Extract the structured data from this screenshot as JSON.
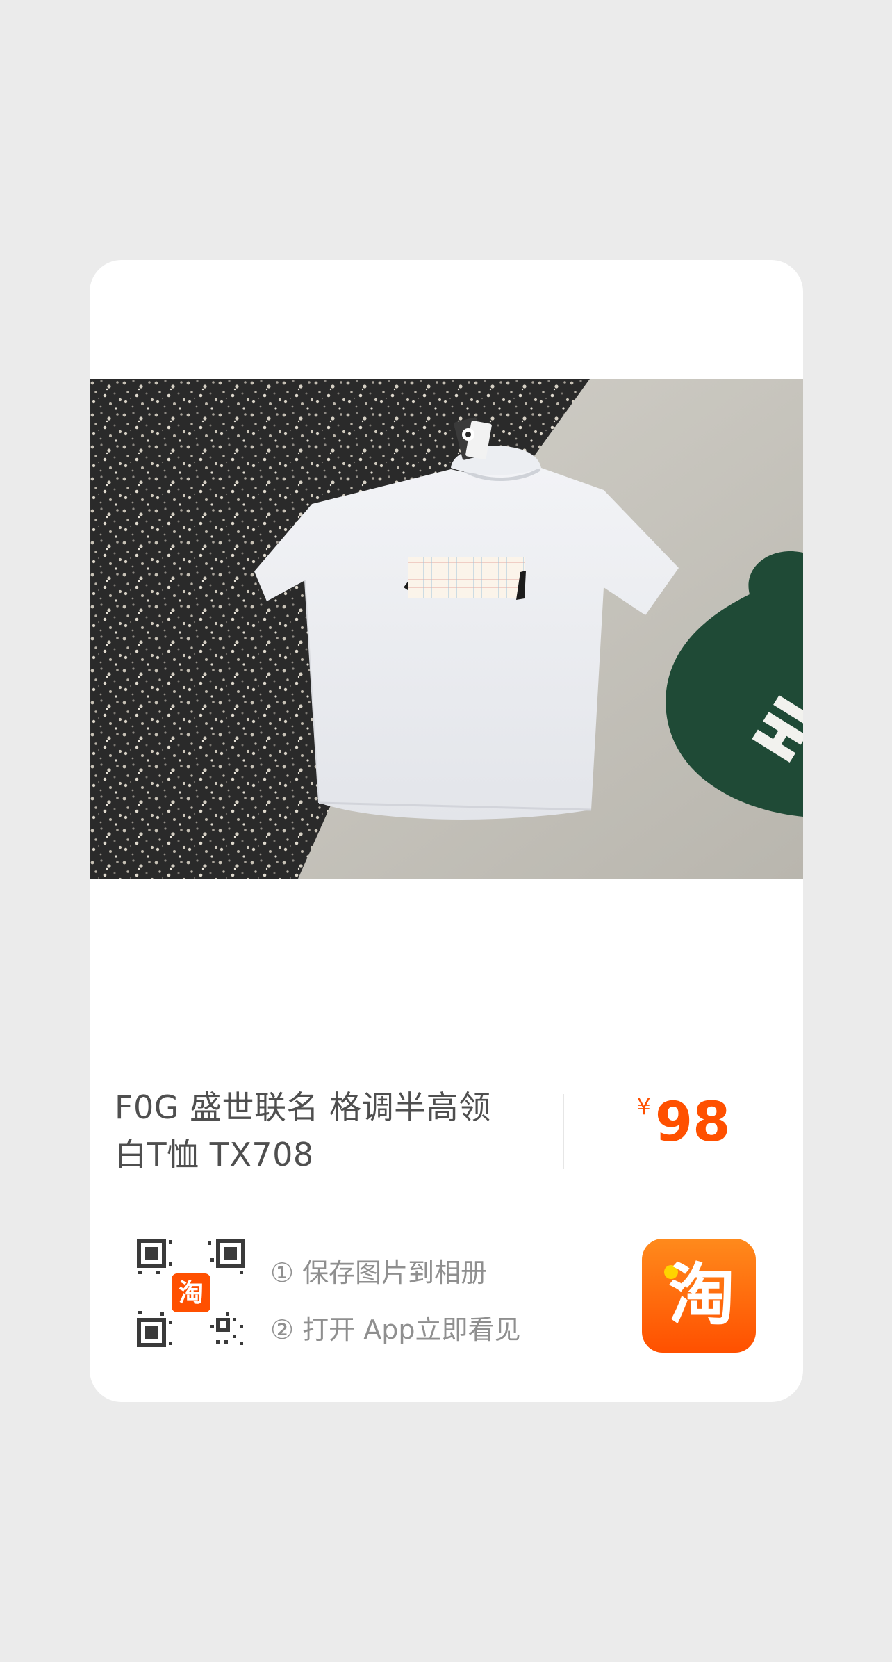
{
  "product": {
    "title_line1": "F0G 盛世联名 格调半高领",
    "title_line2": "白T恤 TX708",
    "currency_symbol": "¥",
    "price": "98",
    "photo": "white mock-neck t-shirt on a speckled mat and grey floor with a green rug"
  },
  "instructions": {
    "step1": "① 保存图片到相册",
    "step2": "② 打开 App立即看见"
  },
  "app": {
    "icon_glyph": "淘",
    "qr_badge_glyph": "淘"
  },
  "colors": {
    "accent": "#ff5000",
    "background": "#ebebeb",
    "card": "#ffffff",
    "title_text": "#4f4f4f",
    "secondary_text": "#8f8f8f"
  }
}
